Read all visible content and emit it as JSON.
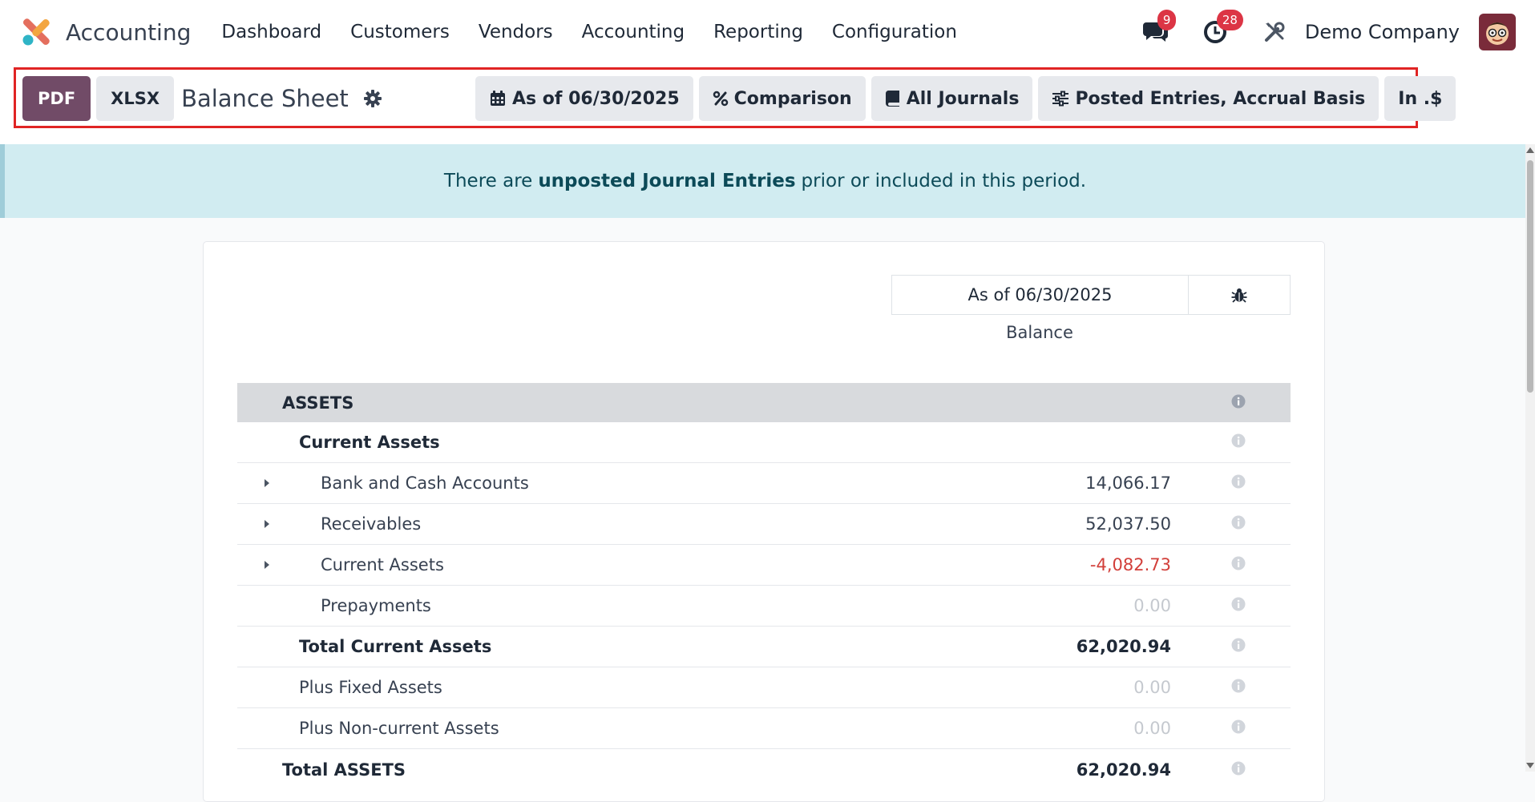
{
  "colors": {
    "brand": "#714b67",
    "badge": "#dc3545",
    "alert_bg": "#d1ecf1",
    "negative": "#d23f3a",
    "highlight": "#e02424"
  },
  "navbar": {
    "app_name": "Accounting",
    "menu": [
      "Dashboard",
      "Customers",
      "Vendors",
      "Accounting",
      "Reporting",
      "Configuration"
    ],
    "messages_count": "9",
    "activities_count": "28",
    "company": "Demo Company"
  },
  "control_panel": {
    "pdf_label": "PDF",
    "xlsx_label": "XLSX",
    "title": "Balance Sheet",
    "filters": {
      "date": "As of 06/30/2025",
      "comparison": "Comparison",
      "journals": "All Journals",
      "entries": "Posted Entries, Accrual Basis",
      "currency": "In .$"
    }
  },
  "alert": {
    "prefix": "There are",
    "bold": "unposted Journal Entries",
    "suffix": "prior or included in this period."
  },
  "report": {
    "column_date": "As of 06/30/2025",
    "column_label": "Balance",
    "rows": [
      {
        "label": "ASSETS",
        "value": ""
      },
      {
        "label": "Current Assets",
        "value": ""
      },
      {
        "label": "Bank and Cash Accounts",
        "value": "14,066.17"
      },
      {
        "label": "Receivables",
        "value": "52,037.50"
      },
      {
        "label": "Current Assets",
        "value": "-4,082.73"
      },
      {
        "label": "Prepayments",
        "value": "0.00"
      },
      {
        "label": "Total Current Assets",
        "value": "62,020.94"
      },
      {
        "label": "Plus Fixed Assets",
        "value": "0.00"
      },
      {
        "label": "Plus Non-current Assets",
        "value": "0.00"
      },
      {
        "label": "Total ASSETS",
        "value": "62,020.94"
      }
    ]
  }
}
